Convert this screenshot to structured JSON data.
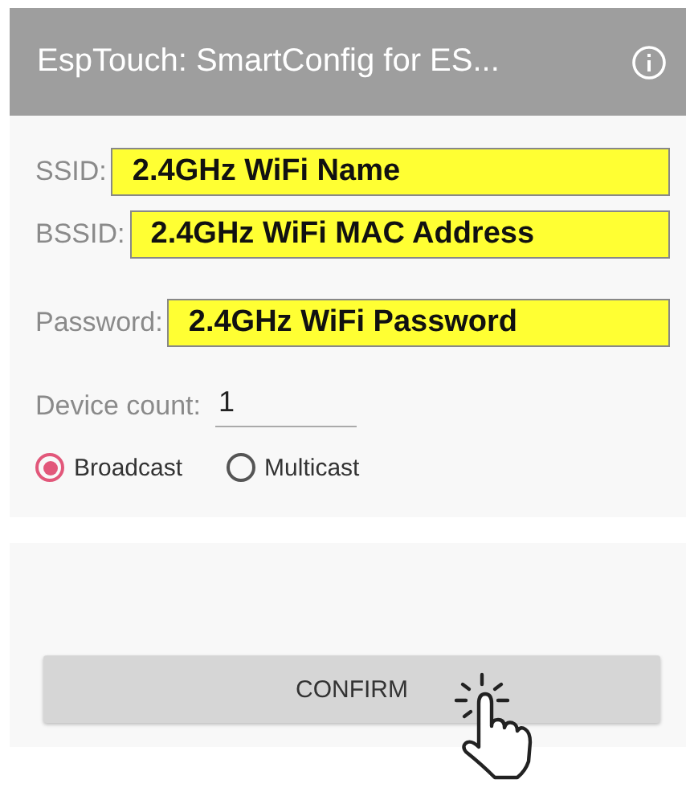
{
  "app_bar": {
    "title": "EspTouch: SmartConfig for ES..."
  },
  "fields": [
    {
      "label": "SSID:",
      "value": "2.4GHz WiFi Name"
    },
    {
      "label": "BSSID:",
      "value": "2.4GHz WiFi MAC Address"
    },
    {
      "label": "Password:",
      "value": "2.4GHz WiFi Password"
    }
  ],
  "device_count": {
    "label": "Device count:",
    "value": "1"
  },
  "modes": [
    {
      "label": "Broadcast",
      "selected": true
    },
    {
      "label": "Multicast",
      "selected": false
    }
  ],
  "confirm_button": {
    "label": "CONFIRM"
  }
}
